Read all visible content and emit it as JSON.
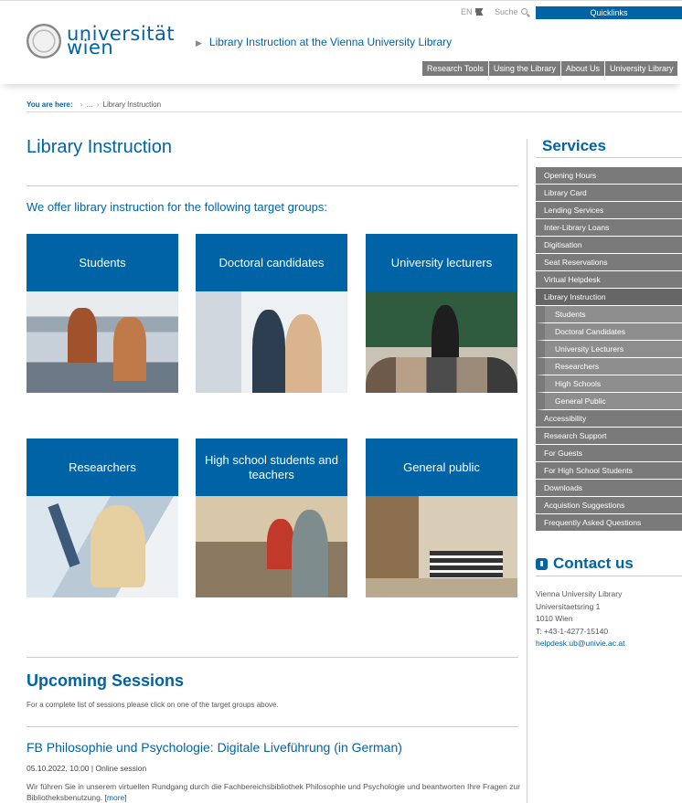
{
  "header": {
    "logo_line1": "universität",
    "logo_line2": "wien",
    "title": "Library Instruction at the Vienna University Library",
    "lang": "EN",
    "search": "Suche",
    "quicklinks": "Quicklinks",
    "nav": [
      "Research Tools",
      "Using the Library",
      "About Us",
      "University Library"
    ]
  },
  "breadcrumb": {
    "label": "You are here:",
    "ellipsis": "...",
    "current": "Library Instruction"
  },
  "main": {
    "title": "Library Instruction",
    "intro": "We offer library instruction for the following target groups:",
    "tiles": [
      {
        "label": "Students"
      },
      {
        "label": "Doctoral candidates"
      },
      {
        "label": "University lecturers"
      },
      {
        "label": "Researchers"
      },
      {
        "label": "High school students and teachers"
      },
      {
        "label": "General public"
      }
    ],
    "sessions": {
      "title": "Upcoming Sessions",
      "note": "For a complete list of sessions please click on one of the target groups above.",
      "event": {
        "title": "FB Philosophie und Psychologie: Digitale Liveführung (in German)",
        "datetime": "05.10.2022, 10:00",
        "separator": " | ",
        "format": "Online session",
        "description": "Wir führen Sie in unserem virtuellen Rundgang durch die Fachbereichsbibliothek Philosophie und Psychologie und beantworten Ihre Fragen zur Bibliotheksbenutzung.",
        "more": "[more]"
      }
    }
  },
  "sidebar": {
    "services_title": "Services",
    "items": [
      {
        "label": "Opening Hours"
      },
      {
        "label": "Library Card"
      },
      {
        "label": "Lending Services"
      },
      {
        "label": "Inter-Library Loans"
      },
      {
        "label": "Digitisation"
      },
      {
        "label": "Seat Reservations"
      },
      {
        "label": "Virtual Helpdesk"
      },
      {
        "label": "Library Instruction"
      },
      {
        "label": "Students"
      },
      {
        "label": "Doctoral Candidates"
      },
      {
        "label": "University Lecturers"
      },
      {
        "label": "Researchers"
      },
      {
        "label": "High Schools"
      },
      {
        "label": "General Public"
      },
      {
        "label": "Accessibility"
      },
      {
        "label": "Research Support"
      },
      {
        "label": "For Guests"
      },
      {
        "label": "For High School Students"
      },
      {
        "label": "Downloads"
      },
      {
        "label": "Acquistion Suggestions"
      },
      {
        "label": "Frequently Asked Questions"
      }
    ],
    "contact": {
      "title": "Contact us",
      "name": "Vienna University Library",
      "street": "Universitaetsring 1",
      "city": "1010 Wien",
      "phone": "T: +43-1-4277-15140",
      "email": "helpdesk.ub@univie.ac.at"
    }
  },
  "colors": {
    "brand_blue": "#0063a6",
    "nav_gray": "#7a7a7a"
  }
}
